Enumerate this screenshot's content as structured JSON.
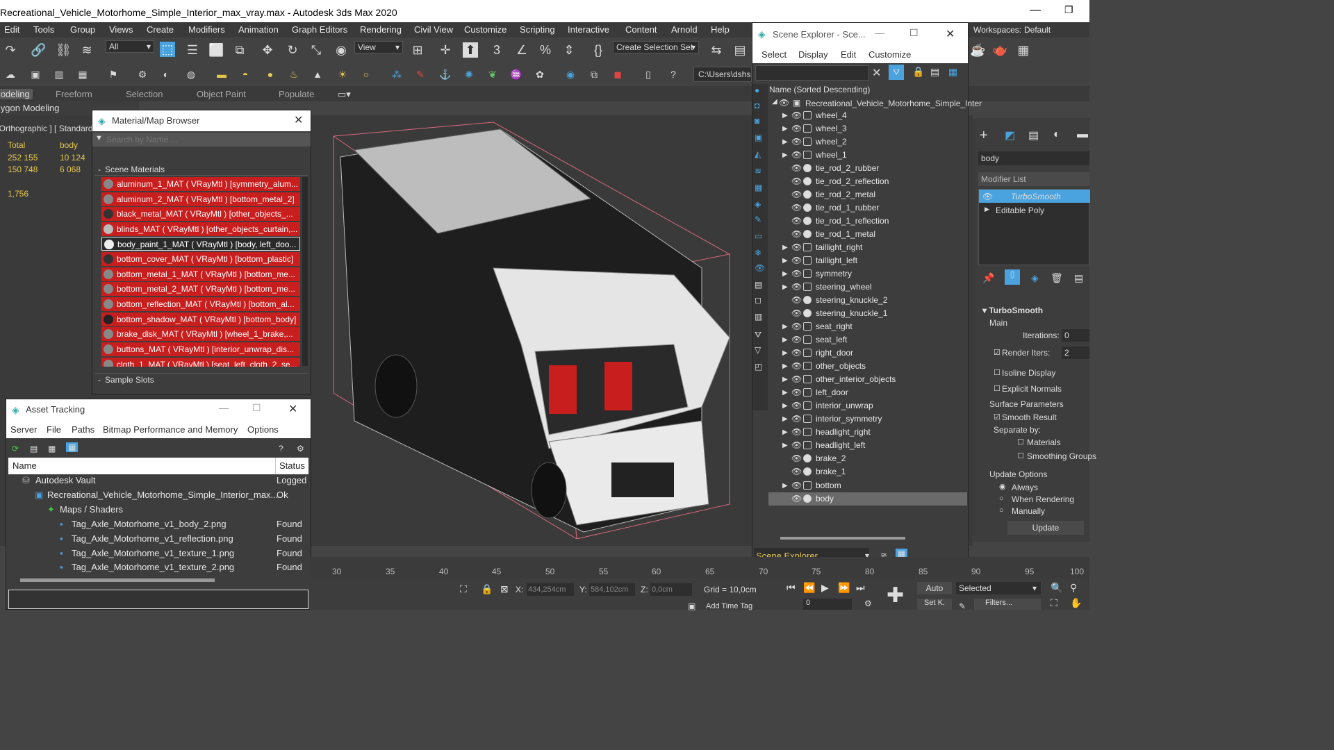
{
  "app": {
    "title": "Recreational_Vehicle_Motorhome_Simple_Interior_max_vray.max - Autodesk 3ds Max 2020"
  },
  "menu": [
    "Edit",
    "Tools",
    "Group",
    "Views",
    "Create",
    "Modifiers",
    "Animation",
    "Graph Editors",
    "Rendering",
    "Civil View",
    "Customize",
    "Scripting",
    "Interactive",
    "Content",
    "Arnold",
    "Help"
  ],
  "workspaces": {
    "label": "Workspaces:",
    "value": "Default"
  },
  "toolbar": {
    "filter_value": "All",
    "view_value": "View",
    "selection_set": "Create Selection Set",
    "path_value": "C:\\Users\\dshsd"
  },
  "ribbon": {
    "tabs": [
      "Modeling",
      "Freeform",
      "Selection",
      "Object Paint",
      "Populate"
    ],
    "sub": "Polygon Modeling"
  },
  "viewport": {
    "label": "[ Orthographic ] [ Standard ]",
    "stats": {
      "col1_header": "Total",
      "col2_header": "body",
      "r1c1": "252 155",
      "r1c2": "10 124",
      "r2c1": "150 748",
      "r2c2": "6 068",
      "fps": "1,756"
    }
  },
  "material_browser": {
    "title": "Material/Map Browser",
    "search_placeholder": "Search by Name ...",
    "section": "Scene Materials",
    "sample_slots": "Sample Slots",
    "items": [
      "aluminum_1_MAT  ( VRayMtl )  [symmetry_alum...",
      "aluminum_2_MAT  ( VRayMtl )  [bottom_metal_2]",
      "black_metal_MAT  ( VRayMtl )  [other_objects_...",
      "blinds_MAT  ( VRayMtl )  [other_objects_curtain,...",
      "body_paint_1_MAT  ( VRayMtl )  [body, left_doo...",
      "bottom_cover_MAT  ( VRayMtl )  [bottom_plastic]",
      "bottom_metal_1_MAT  ( VRayMtl )  [bottom_me...",
      "bottom_metal_2_MAT  ( VRayMtl )  [bottom_me...",
      "bottom_reflection_MAT  ( VRayMtl )  [bottom_al...",
      "bottom_shadow_MAT  ( VRayMtl )  [bottom_body]",
      "brake_disk_MAT  ( VRayMtl )  [wheel_1_brake,...",
      "buttons_MAT  ( VRayMtl )  [interior_unwrap_dis...",
      "cloth_1_MAT  ( VRayMtl )  [seat_left_cloth_2, se..."
    ]
  },
  "asset_tracking": {
    "title": "Asset Tracking",
    "menu": [
      "Server",
      "File",
      "Paths",
      "Bitmap Performance and Memory",
      "Options"
    ],
    "col_name": "Name",
    "col_status": "Status",
    "rows": [
      {
        "name": "Autodesk Vault",
        "status": "Logged"
      },
      {
        "name": "Recreational_Vehicle_Motorhome_Simple_Interior_max...",
        "status": "Ok"
      },
      {
        "name": "Maps / Shaders",
        "status": ""
      },
      {
        "name": "Tag_Axle_Motorhome_v1_body_2.png",
        "status": "Found"
      },
      {
        "name": "Tag_Axle_Motorhome_v1_reflection.png",
        "status": "Found"
      },
      {
        "name": "Tag_Axle_Motorhome_v1_texture_1.png",
        "status": "Found"
      },
      {
        "name": "Tag_Axle_Motorhome_v1_texture_2.png",
        "status": "Found"
      }
    ]
  },
  "scene_explorer": {
    "title": "Scene Explorer - Sce...",
    "menu": [
      "Select",
      "Display",
      "Edit",
      "Customize"
    ],
    "col_header": "Name (Sorted Descending)",
    "root": "Recreational_Vehicle_Motorhome_Simple_Inter",
    "footer": "Scene Explorer",
    "items": [
      {
        "name": "wheel_4",
        "arrow": true
      },
      {
        "name": "wheel_3",
        "arrow": true
      },
      {
        "name": "wheel_2",
        "arrow": true
      },
      {
        "name": "wheel_1",
        "arrow": true
      },
      {
        "name": "tie_rod_2_rubber",
        "arrow": false
      },
      {
        "name": "tie_rod_2_reflection",
        "arrow": false
      },
      {
        "name": "tie_rod_2_metal",
        "arrow": false
      },
      {
        "name": "tie_rod_1_rubber",
        "arrow": false
      },
      {
        "name": "tie_rod_1_reflection",
        "arrow": false
      },
      {
        "name": "tie_rod_1_metal",
        "arrow": false
      },
      {
        "name": "taillight_right",
        "arrow": true
      },
      {
        "name": "taillight_left",
        "arrow": true
      },
      {
        "name": "symmetry",
        "arrow": true
      },
      {
        "name": "steering_wheel",
        "arrow": true
      },
      {
        "name": "steering_knuckle_2",
        "arrow": false
      },
      {
        "name": "steering_knuckle_1",
        "arrow": false
      },
      {
        "name": "seat_right",
        "arrow": true
      },
      {
        "name": "seat_left",
        "arrow": true
      },
      {
        "name": "right_door",
        "arrow": true
      },
      {
        "name": "other_objects",
        "arrow": true
      },
      {
        "name": "other_interior_objects",
        "arrow": true
      },
      {
        "name": "left_door",
        "arrow": true
      },
      {
        "name": "interior_unwrap",
        "arrow": true
      },
      {
        "name": "interior_symmetry",
        "arrow": true
      },
      {
        "name": "headlight_right",
        "arrow": true
      },
      {
        "name": "headlight_left",
        "arrow": true
      },
      {
        "name": "brake_2",
        "arrow": false
      },
      {
        "name": "brake_1",
        "arrow": false
      },
      {
        "name": "bottom",
        "arrow": true
      },
      {
        "name": "body",
        "arrow": false
      }
    ]
  },
  "command_panel": {
    "object_name": "body",
    "modifier_list": "Modifier List",
    "stack": [
      "TurboSmooth",
      "Editable Poly"
    ],
    "rollout": "TurboSmooth",
    "main": "Main",
    "iterations_label": "Iterations:",
    "iterations_value": "0",
    "render_iters_label": "Render Iters:",
    "render_iters_value": "2",
    "isoline": "Isoline Display",
    "explicit": "Explicit Normals",
    "surface": "Surface Parameters",
    "smooth_result": "Smooth Result",
    "separate": "Separate by:",
    "materials": "Materials",
    "smoothing_groups": "Smoothing Groups",
    "update_options": "Update Options",
    "always": "Always",
    "when_rendering": "When Rendering",
    "manually": "Manually",
    "update_btn": "Update"
  },
  "timeline": {
    "ticks": [
      "30",
      "35",
      "40",
      "45",
      "50",
      "55",
      "60",
      "65",
      "70",
      "75",
      "80",
      "85",
      "90",
      "95",
      "100"
    ]
  },
  "status": {
    "x_label": "X:",
    "x_value": "434,254cm",
    "y_label": "Y:",
    "y_value": "584,102cm",
    "z_label": "Z:",
    "z_value": "0,0cm",
    "grid": "Grid = 10,0cm",
    "add_time_tag": "Add Time Tag",
    "auto": "Auto",
    "selected": "Selected",
    "setk": "Set K.",
    "filters": "Filters...",
    "frame": "0"
  },
  "colors": {
    "accent": "#4aa3df",
    "material_red": "#c81e1e",
    "viewport_bg": "#3a3a3a",
    "stats": "#e6c84e"
  }
}
